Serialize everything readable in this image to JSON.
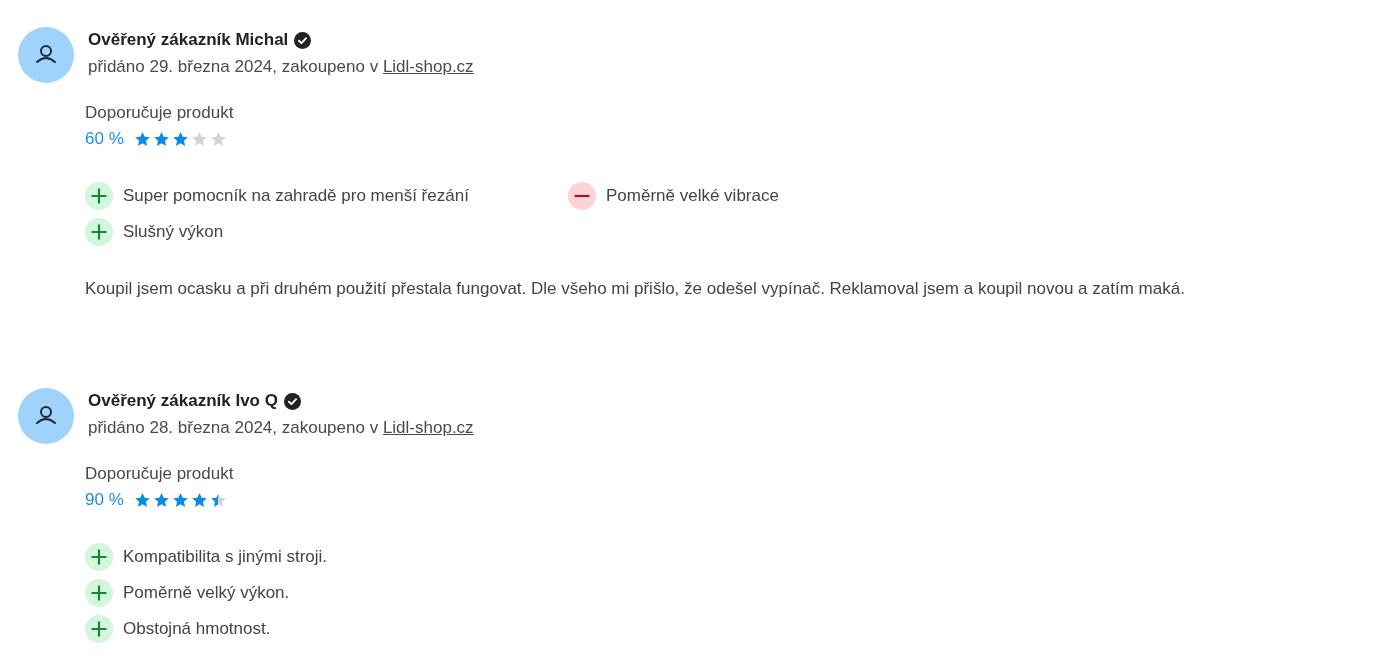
{
  "reviews": [
    {
      "author": "Ověřený zákazník Michal",
      "verified": true,
      "added": "přidáno 29. března 2024, zakoupeno v",
      "shop": "Lidl-shop.cz",
      "recommend_label": "Doporučuje produkt",
      "percent": "60 %",
      "stars": 3,
      "pros": [
        "Super pomocník na zahradě pro menší řezání",
        "Slušný výkon"
      ],
      "cons": [
        "Poměrně velké vibrace"
      ],
      "text": "Koupil jsem ocasku a při druhém použití přestala fungovat. Dle všeho mi přišlo, že odešel vypínač. Reklamoval jsem a koupil novou a zatím maká."
    },
    {
      "author": "Ověřený zákazník Ivo Q",
      "verified": true,
      "added": "přidáno 28. března 2024, zakoupeno v",
      "shop": "Lidl-shop.cz",
      "recommend_label": "Doporučuje produkt",
      "percent": "90 %",
      "stars": 4.5,
      "pros": [
        "Kompatibilita s jinými stroji.",
        "Poměrně velký výkon.",
        "Obstojná hmotnost."
      ]
    }
  ]
}
